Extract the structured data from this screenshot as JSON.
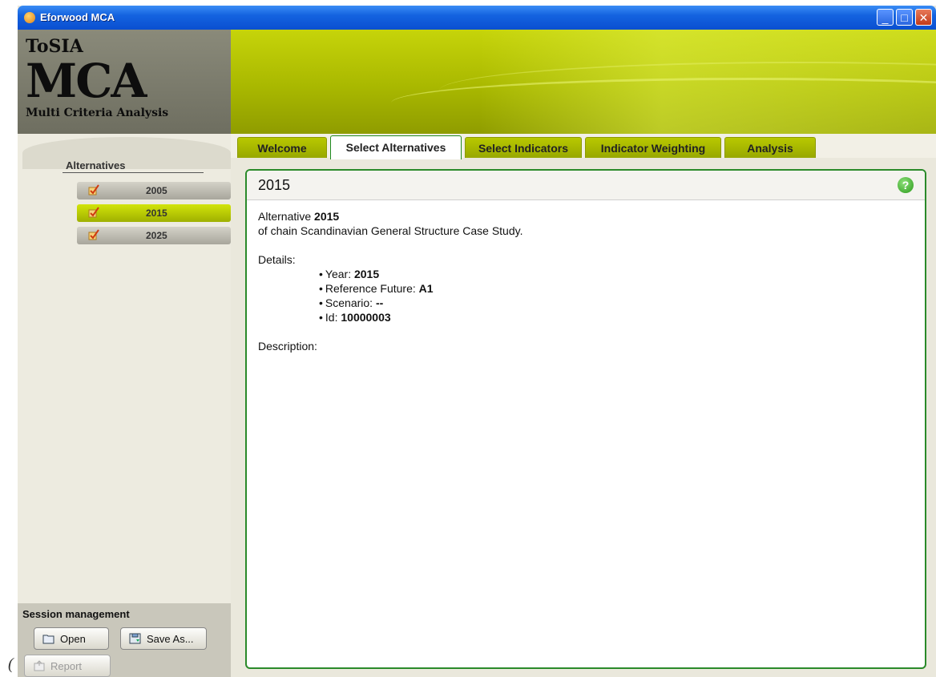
{
  "window": {
    "title": "Eforwood MCA",
    "min": "_",
    "max": "□",
    "close": "✕"
  },
  "brand": {
    "line1": "ToSIA",
    "line2": "MCA",
    "line3": "Multi Criteria Analysis"
  },
  "sidebar": {
    "heading": "Alternatives",
    "items": [
      {
        "label": "2005",
        "selected": false
      },
      {
        "label": "2015",
        "selected": true
      },
      {
        "label": "2025",
        "selected": false
      }
    ]
  },
  "session": {
    "title": "Session management",
    "open": "Open",
    "save_as": "Save As...",
    "report": "Report"
  },
  "tabs": [
    {
      "label": "Welcome"
    },
    {
      "label": "Select Alternatives"
    },
    {
      "label": "Select Indicators"
    },
    {
      "label": "Indicator Weighting"
    },
    {
      "label": "Analysis"
    }
  ],
  "content": {
    "title": "2015",
    "alt_prefix": "Alternative ",
    "alt_name": "2015",
    "chain_line": "of chain Scandinavian General Structure Case Study.",
    "details_label": "Details:",
    "details": [
      {
        "key": "Year: ",
        "value": "2015"
      },
      {
        "key": "Reference Future: ",
        "value": "A1"
      },
      {
        "key": "Scenario: ",
        "value": "--"
      },
      {
        "key": "Id: ",
        "value": "10000003"
      }
    ],
    "description_label": "Description:"
  },
  "edge_mark": "("
}
